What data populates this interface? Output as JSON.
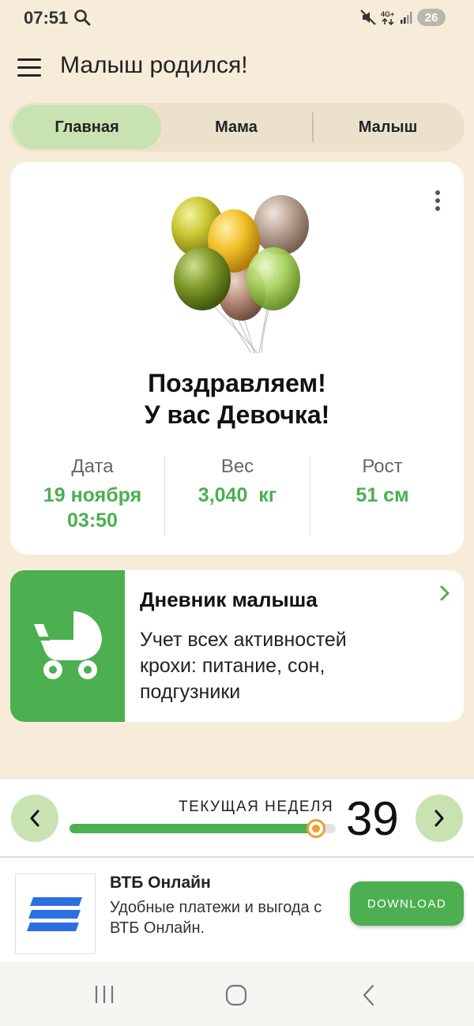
{
  "status_bar": {
    "time": "07:51",
    "battery": "26",
    "icons": [
      "search-icon",
      "mute-icon",
      "network-4g-icon",
      "signal-icon"
    ]
  },
  "app_bar": {
    "title": "Малыш родился!",
    "menu_icon": "hamburger-menu-icon"
  },
  "tabs": [
    {
      "label": "Главная",
      "active": true
    },
    {
      "label": "Мама",
      "active": false
    },
    {
      "label": "Малыш",
      "active": false
    }
  ],
  "main_card": {
    "line1": "Поздравляем!",
    "line2": "У вас Девочка!",
    "stats": {
      "date_label": "Дата",
      "date_value": "19 ноября",
      "time_value": "03:50",
      "weight_label": "Вес",
      "weight_value": "3,040  кг",
      "height_label": "Рост",
      "height_value": "51 см"
    }
  },
  "diary": {
    "title": "Дневник малыша",
    "description": "Учет всех активностей крохи: питание, сон, подгузники",
    "icon": "baby-stroller-icon"
  },
  "week": {
    "label": "ТЕКУЩАЯ НЕДЕЛЯ",
    "number": "39",
    "progress_fraction": 0.925
  },
  "ad": {
    "title": "ВТБ Онлайн",
    "description": "Удобные платежи и выгода с ВТБ Онлайн.",
    "button": "DOWNLOAD"
  },
  "colors": {
    "accent_green": "#4caf50",
    "tab_active": "#c8e2b2",
    "background": "#f7ecd9",
    "thumb_orange": "#f39c2e",
    "vtb_blue": "#2c6fe0"
  }
}
